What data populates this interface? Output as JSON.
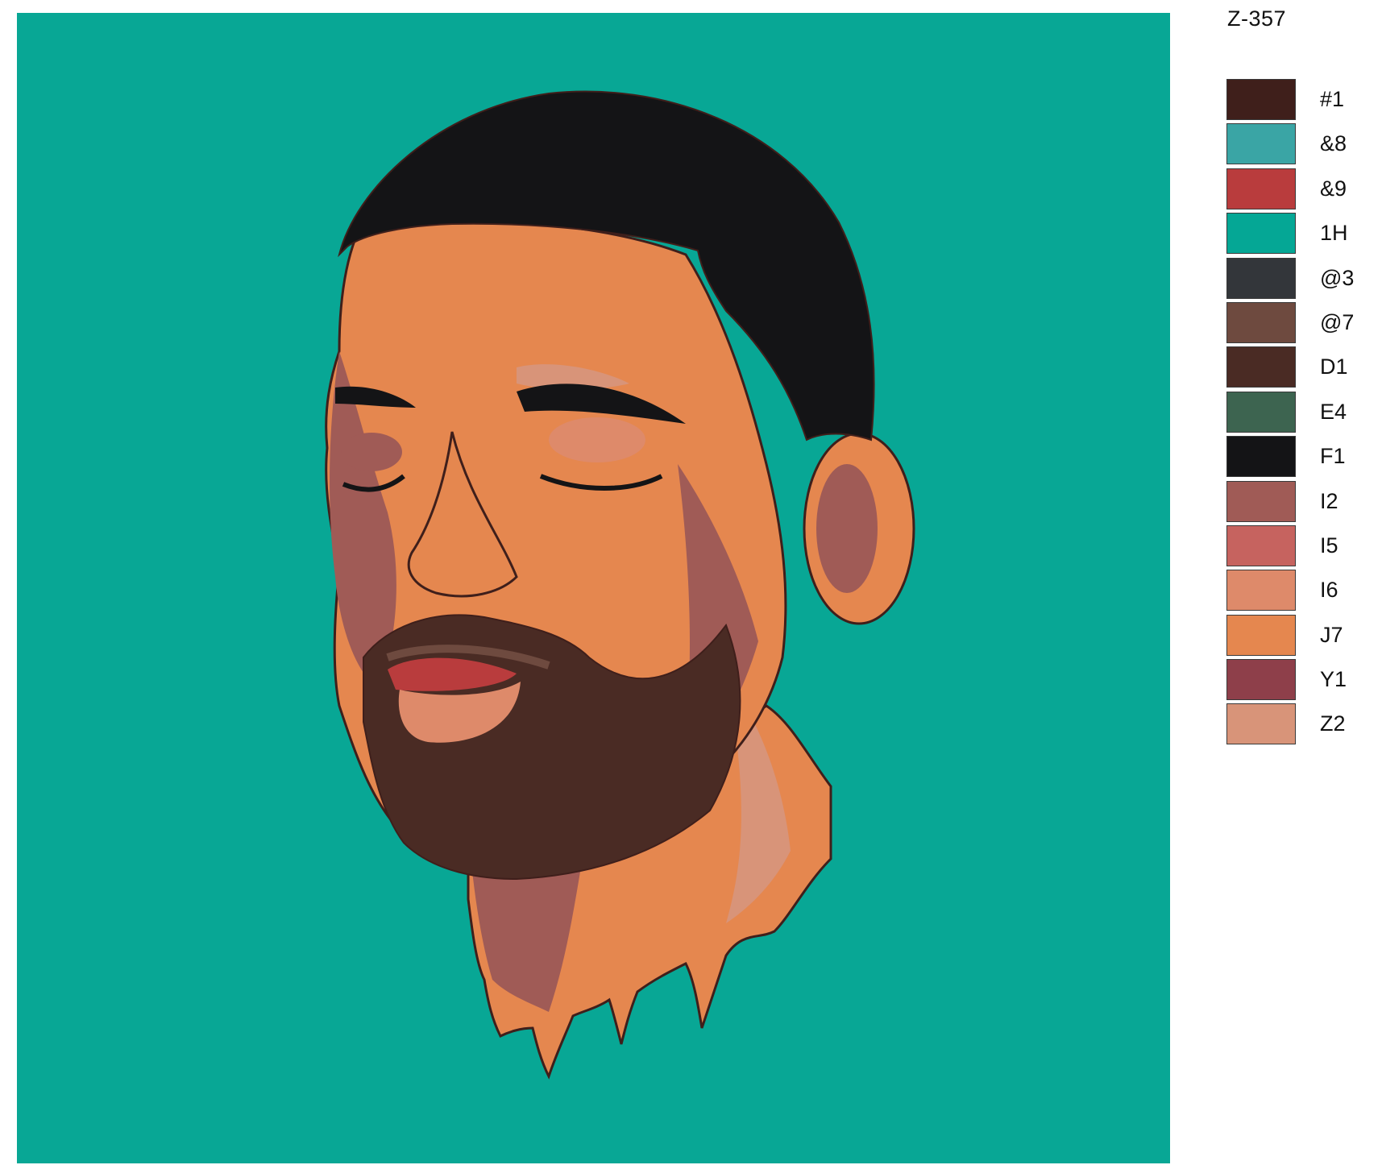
{
  "painting": {
    "background_color": "#08a795",
    "subject": "portrait-illustration"
  },
  "code": "Z-357",
  "palette": [
    {
      "label": "#1",
      "color": "#3f1f1b"
    },
    {
      "label": "&8",
      "color": "#3aa5a5"
    },
    {
      "label": "&9",
      "color": "#b93c3d"
    },
    {
      "label": "1H",
      "color": "#05a795"
    },
    {
      "label": "@3",
      "color": "#33363a"
    },
    {
      "label": "@7",
      "color": "#6e4a3f"
    },
    {
      "label": "D1",
      "color": "#4a2b24"
    },
    {
      "label": "E4",
      "color": "#3d6450"
    },
    {
      "label": "F1",
      "color": "#141416"
    },
    {
      "label": "I2",
      "color": "#a05b56"
    },
    {
      "label": "I5",
      "color": "#c6635f"
    },
    {
      "label": "I6",
      "color": "#de8a6a"
    },
    {
      "label": "J7",
      "color": "#e5874f"
    },
    {
      "label": "Y1",
      "color": "#8e3f4a"
    },
    {
      "label": "Z2",
      "color": "#d89479"
    }
  ]
}
